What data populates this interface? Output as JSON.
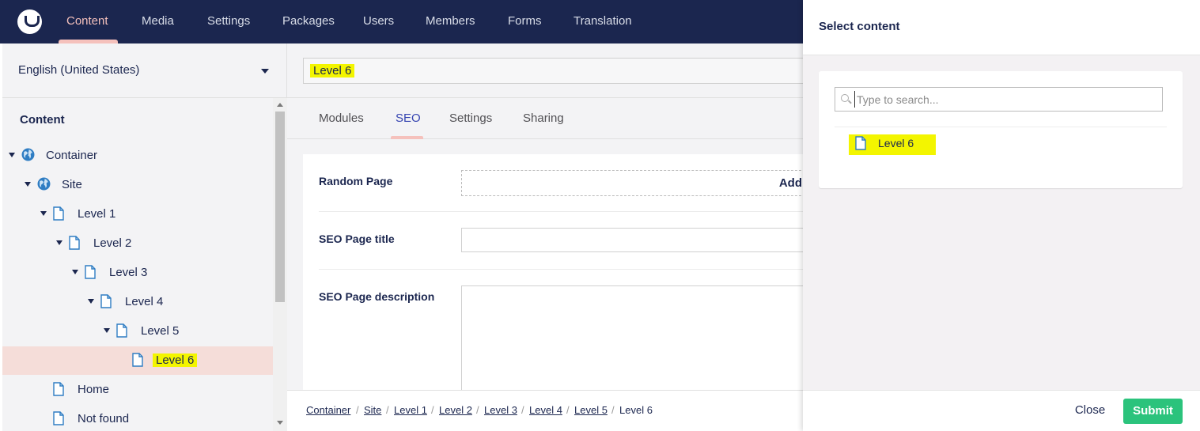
{
  "nav": {
    "items": [
      "Content",
      "Media",
      "Settings",
      "Packages",
      "Users",
      "Members",
      "Forms",
      "Translation"
    ],
    "active": "Content"
  },
  "tree": {
    "language": "English (United States)",
    "heading": "Content",
    "items": [
      {
        "label": "Container",
        "icon": "globe-icon"
      },
      {
        "label": "Site",
        "icon": "globe-icon"
      },
      {
        "label": "Level 1",
        "icon": "document-icon"
      },
      {
        "label": "Level 2",
        "icon": "document-icon"
      },
      {
        "label": "Level 3",
        "icon": "document-icon"
      },
      {
        "label": "Level 4",
        "icon": "document-icon"
      },
      {
        "label": "Level 5",
        "icon": "document-icon"
      },
      {
        "label": "Level 6",
        "icon": "document-icon"
      },
      {
        "label": "Home",
        "icon": "document-icon"
      },
      {
        "label": "Not found",
        "icon": "document-icon"
      }
    ],
    "selected": "Level 6"
  },
  "editor": {
    "name": "Level 6",
    "tabs": [
      "Modules",
      "SEO",
      "Settings",
      "Sharing"
    ],
    "active_tab": "SEO",
    "properties": {
      "random_page": "Random Page",
      "add_label": "Add",
      "seo_title": "SEO Page title",
      "seo_description": "SEO Page description"
    },
    "breadcrumb": [
      "Container",
      "Site",
      "Level 1",
      "Level 2",
      "Level 3",
      "Level 4",
      "Level 5",
      "Level 6"
    ]
  },
  "dialog": {
    "title": "Select content",
    "search_placeholder": "Type to search...",
    "results": [
      {
        "label": "Level 6",
        "icon": "document-icon"
      }
    ],
    "close_label": "Close",
    "submit_label": "Submit"
  },
  "colors": {
    "topbar": "#1b264f",
    "accent": "#f5c1bc",
    "highlight": "#f3f500",
    "submit": "#2bc37c",
    "tab_active": "#3544b1"
  }
}
